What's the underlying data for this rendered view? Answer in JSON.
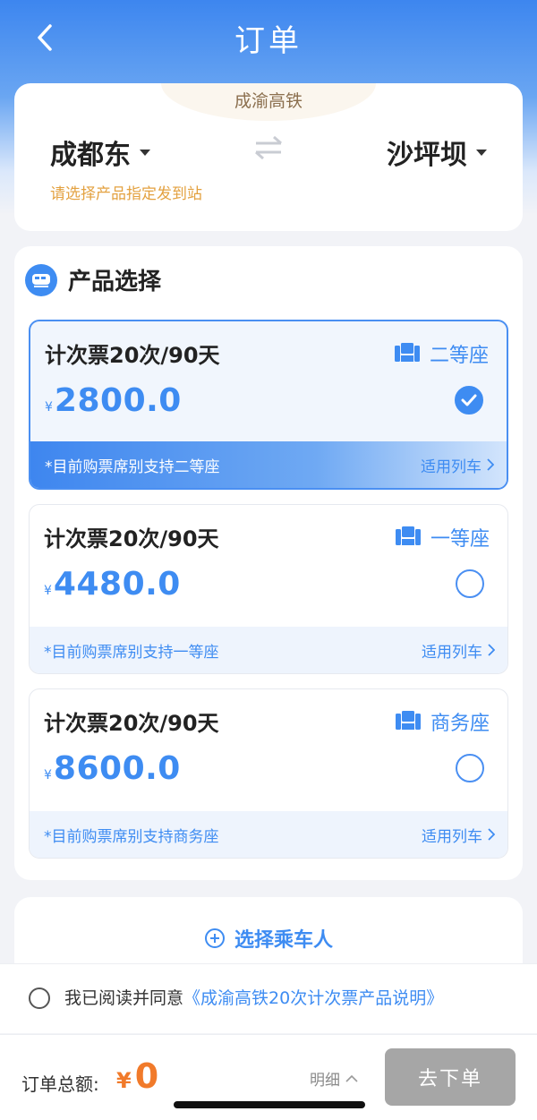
{
  "header": {
    "title": "订单"
  },
  "route": {
    "line_name": "成渝高铁",
    "from_station": "成都东",
    "to_station": "沙坪坝",
    "hint": "请选择产品指定发到站"
  },
  "products": {
    "section_title": "产品选择",
    "items": [
      {
        "name": "计次票20次/90天",
        "seat": "二等座",
        "currency": "¥",
        "price": "2800.0",
        "note": "*目前购票席别支持二等座",
        "applicable": "适用列车",
        "selected": true
      },
      {
        "name": "计次票20次/90天",
        "seat": "一等座",
        "currency": "¥",
        "price": "4480.0",
        "note": "*目前购票席别支持一等座",
        "applicable": "适用列车",
        "selected": false
      },
      {
        "name": "计次票20次/90天",
        "seat": "商务座",
        "currency": "¥",
        "price": "8600.0",
        "note": "*目前购票席别支持商务座",
        "applicable": "适用列车",
        "selected": false
      }
    ]
  },
  "passenger": {
    "add_label": "选择乘车人"
  },
  "agreement": {
    "prefix": "我已阅读并同意",
    "link": "《成渝高铁20次计次票产品说明》"
  },
  "order": {
    "total_label": "订单总额:",
    "currency": "¥",
    "total": "0",
    "detail_label": "明细",
    "submit_label": "去下单"
  },
  "colors": {
    "accent": "#3e8cf2",
    "price_orange": "#f17a2a",
    "hint_orange": "#e3a140",
    "disabled_button": "#a6a6a6"
  }
}
